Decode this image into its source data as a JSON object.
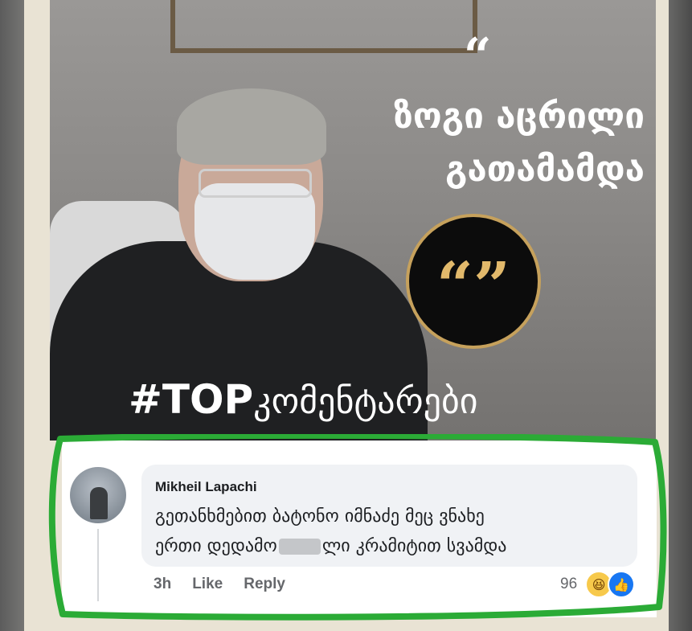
{
  "image": {
    "quote_mark": "“",
    "headline_line1": "ზოგი აცრილი",
    "headline_line2": "გათამამდა",
    "badge_quote": "“”",
    "tag_hash": "#TOP",
    "tag_word": "კომენტარები",
    "colors": {
      "gold": "#c6a15c",
      "photo_bg": "#8d8b89"
    }
  },
  "comment": {
    "author": "Mikheil Lapachi",
    "text_line1": "გეთანხმებით ბატონო იმნაძე მეც ვნახე",
    "text_line2_start": "ერთი დედამო",
    "text_line2_end": "ლი კრამიტით სვამდა",
    "time": "3h",
    "like_label": "Like",
    "reply_label": "Reply",
    "reaction_count": "96",
    "reactions": [
      "haha-emoji",
      "like-emoji"
    ],
    "colors": {
      "bubble": "#f0f2f5",
      "highlight": "#2bab36",
      "like_blue": "#1877f2"
    }
  }
}
